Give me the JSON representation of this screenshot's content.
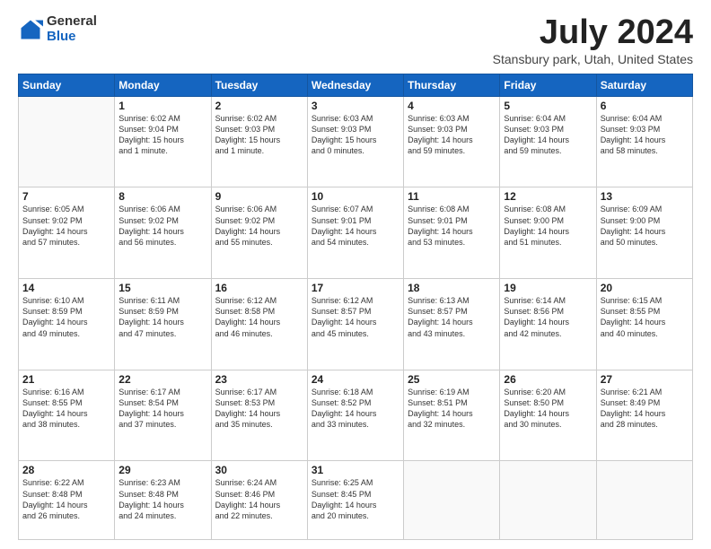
{
  "logo": {
    "general": "General",
    "blue": "Blue"
  },
  "title": "July 2024",
  "subtitle": "Stansbury park, Utah, United States",
  "days": [
    "Sunday",
    "Monday",
    "Tuesday",
    "Wednesday",
    "Thursday",
    "Friday",
    "Saturday"
  ],
  "weeks": [
    [
      {
        "date": "",
        "info": ""
      },
      {
        "date": "1",
        "info": "Sunrise: 6:02 AM\nSunset: 9:04 PM\nDaylight: 15 hours\nand 1 minute."
      },
      {
        "date": "2",
        "info": "Sunrise: 6:02 AM\nSunset: 9:03 PM\nDaylight: 15 hours\nand 1 minute."
      },
      {
        "date": "3",
        "info": "Sunrise: 6:03 AM\nSunset: 9:03 PM\nDaylight: 15 hours\nand 0 minutes."
      },
      {
        "date": "4",
        "info": "Sunrise: 6:03 AM\nSunset: 9:03 PM\nDaylight: 14 hours\nand 59 minutes."
      },
      {
        "date": "5",
        "info": "Sunrise: 6:04 AM\nSunset: 9:03 PM\nDaylight: 14 hours\nand 59 minutes."
      },
      {
        "date": "6",
        "info": "Sunrise: 6:04 AM\nSunset: 9:03 PM\nDaylight: 14 hours\nand 58 minutes."
      }
    ],
    [
      {
        "date": "7",
        "info": "Sunrise: 6:05 AM\nSunset: 9:02 PM\nDaylight: 14 hours\nand 57 minutes."
      },
      {
        "date": "8",
        "info": "Sunrise: 6:06 AM\nSunset: 9:02 PM\nDaylight: 14 hours\nand 56 minutes."
      },
      {
        "date": "9",
        "info": "Sunrise: 6:06 AM\nSunset: 9:02 PM\nDaylight: 14 hours\nand 55 minutes."
      },
      {
        "date": "10",
        "info": "Sunrise: 6:07 AM\nSunset: 9:01 PM\nDaylight: 14 hours\nand 54 minutes."
      },
      {
        "date": "11",
        "info": "Sunrise: 6:08 AM\nSunset: 9:01 PM\nDaylight: 14 hours\nand 53 minutes."
      },
      {
        "date": "12",
        "info": "Sunrise: 6:08 AM\nSunset: 9:00 PM\nDaylight: 14 hours\nand 51 minutes."
      },
      {
        "date": "13",
        "info": "Sunrise: 6:09 AM\nSunset: 9:00 PM\nDaylight: 14 hours\nand 50 minutes."
      }
    ],
    [
      {
        "date": "14",
        "info": "Sunrise: 6:10 AM\nSunset: 8:59 PM\nDaylight: 14 hours\nand 49 minutes."
      },
      {
        "date": "15",
        "info": "Sunrise: 6:11 AM\nSunset: 8:59 PM\nDaylight: 14 hours\nand 47 minutes."
      },
      {
        "date": "16",
        "info": "Sunrise: 6:12 AM\nSunset: 8:58 PM\nDaylight: 14 hours\nand 46 minutes."
      },
      {
        "date": "17",
        "info": "Sunrise: 6:12 AM\nSunset: 8:57 PM\nDaylight: 14 hours\nand 45 minutes."
      },
      {
        "date": "18",
        "info": "Sunrise: 6:13 AM\nSunset: 8:57 PM\nDaylight: 14 hours\nand 43 minutes."
      },
      {
        "date": "19",
        "info": "Sunrise: 6:14 AM\nSunset: 8:56 PM\nDaylight: 14 hours\nand 42 minutes."
      },
      {
        "date": "20",
        "info": "Sunrise: 6:15 AM\nSunset: 8:55 PM\nDaylight: 14 hours\nand 40 minutes."
      }
    ],
    [
      {
        "date": "21",
        "info": "Sunrise: 6:16 AM\nSunset: 8:55 PM\nDaylight: 14 hours\nand 38 minutes."
      },
      {
        "date": "22",
        "info": "Sunrise: 6:17 AM\nSunset: 8:54 PM\nDaylight: 14 hours\nand 37 minutes."
      },
      {
        "date": "23",
        "info": "Sunrise: 6:17 AM\nSunset: 8:53 PM\nDaylight: 14 hours\nand 35 minutes."
      },
      {
        "date": "24",
        "info": "Sunrise: 6:18 AM\nSunset: 8:52 PM\nDaylight: 14 hours\nand 33 minutes."
      },
      {
        "date": "25",
        "info": "Sunrise: 6:19 AM\nSunset: 8:51 PM\nDaylight: 14 hours\nand 32 minutes."
      },
      {
        "date": "26",
        "info": "Sunrise: 6:20 AM\nSunset: 8:50 PM\nDaylight: 14 hours\nand 30 minutes."
      },
      {
        "date": "27",
        "info": "Sunrise: 6:21 AM\nSunset: 8:49 PM\nDaylight: 14 hours\nand 28 minutes."
      }
    ],
    [
      {
        "date": "28",
        "info": "Sunrise: 6:22 AM\nSunset: 8:48 PM\nDaylight: 14 hours\nand 26 minutes."
      },
      {
        "date": "29",
        "info": "Sunrise: 6:23 AM\nSunset: 8:48 PM\nDaylight: 14 hours\nand 24 minutes."
      },
      {
        "date": "30",
        "info": "Sunrise: 6:24 AM\nSunset: 8:46 PM\nDaylight: 14 hours\nand 22 minutes."
      },
      {
        "date": "31",
        "info": "Sunrise: 6:25 AM\nSunset: 8:45 PM\nDaylight: 14 hours\nand 20 minutes."
      },
      {
        "date": "",
        "info": ""
      },
      {
        "date": "",
        "info": ""
      },
      {
        "date": "",
        "info": ""
      }
    ]
  ]
}
